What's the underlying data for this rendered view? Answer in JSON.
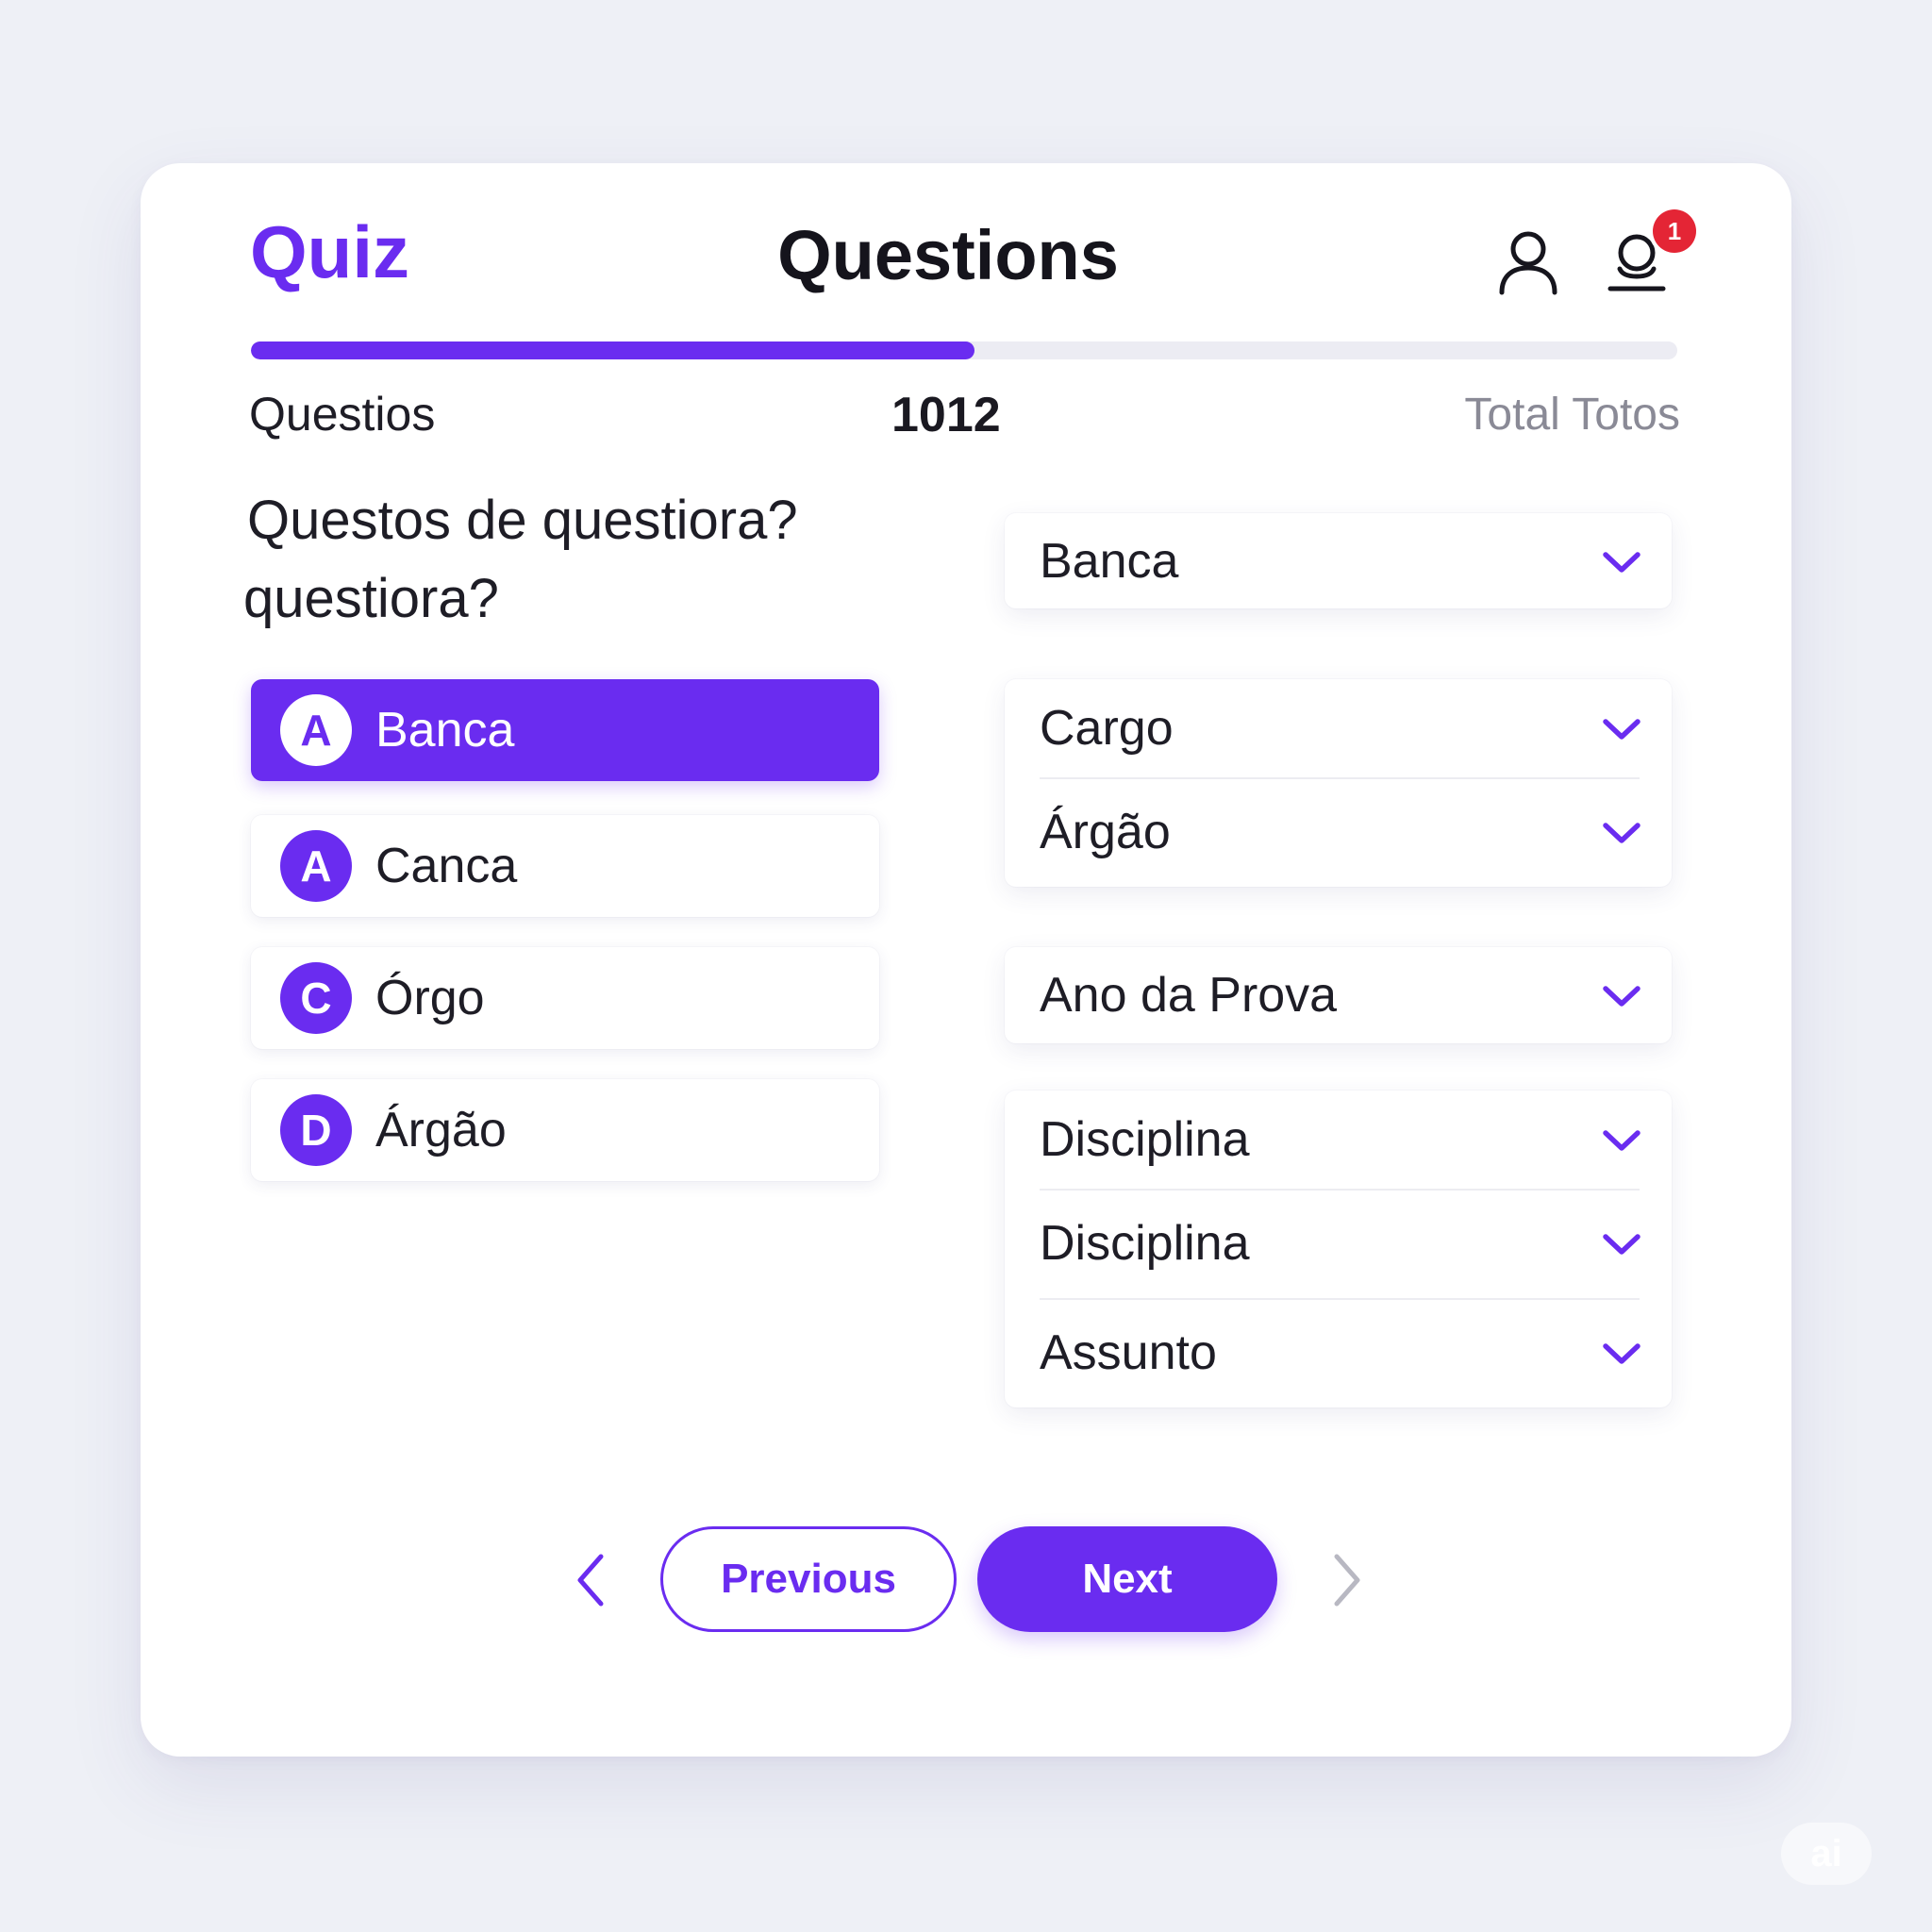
{
  "header": {
    "brand": "Quiz",
    "title": "Questions",
    "notification_count": "1",
    "icons": [
      "user-icon",
      "user-notification-icon"
    ]
  },
  "progress": {
    "fraction": 0.507
  },
  "stats": {
    "label": "Questios",
    "value": "1012",
    "total_label": "Total Totos"
  },
  "question": {
    "line1": "Questos de questiora?",
    "line2": "questiora?"
  },
  "options": [
    {
      "letter": "A",
      "text": "Banca",
      "selected": true
    },
    {
      "letter": "A",
      "text": "Canca",
      "selected": false
    },
    {
      "letter": "C",
      "text": "Órgo",
      "selected": false
    },
    {
      "letter": "D",
      "text": "Árgão",
      "selected": false
    }
  ],
  "filters": {
    "group1": [
      "Banca"
    ],
    "group2": [
      "Cargo",
      "Árgão"
    ],
    "group3": [
      "Ano da Prova"
    ],
    "group4": [
      "Disciplina",
      "Disciplina",
      "Assunto"
    ]
  },
  "nav": {
    "previous_label": "Previous",
    "next_label": "Next"
  },
  "watermark": "ai",
  "colors": {
    "accent": "#6a2cf0",
    "background": "#eef0f6",
    "card": "#ffffff",
    "badge": "#e42535",
    "text": "#1e1d26",
    "muted": "#8a8a96"
  }
}
